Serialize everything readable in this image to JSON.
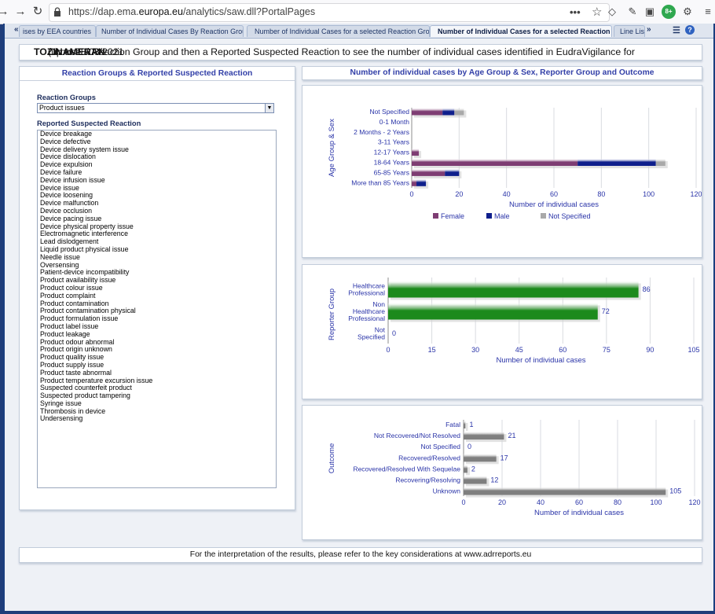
{
  "browser": {
    "url_prefix": "https://dap.ema.",
    "url_domain": "europa.eu",
    "url_suffix": "/analytics/saw.dll?PortalPages",
    "more_label": "•••"
  },
  "tabs": [
    {
      "label": "ises by EEA countries",
      "active": false
    },
    {
      "label": "Number of Individual Cases By Reaction Groups",
      "active": false
    },
    {
      "label": "Number of Individual Cases for a selected Reaction Group",
      "active": false
    },
    {
      "label": "Number of Individual Cases for a selected Reaction",
      "active": true
    },
    {
      "label": "Line Listi",
      "active": false
    }
  ],
  "banner": {
    "text_before": "Choose a Reaction Group and then a Reported Suspected Reaction to see the number of individual cases identified in EudraVigilance for ",
    "drug": "TOZINAMERAN",
    "text_after": " (up to 28/08/2021"
  },
  "left_panel": {
    "title": "Reaction Groups & Reported Suspected Reaction",
    "group_label": "Reaction Groups",
    "group_value": "Product issues",
    "reaction_label": "Reported Suspected Reaction",
    "reactions": [
      "Device breakage",
      "Device defective",
      "Device delivery system issue",
      "Device dislocation",
      "Device expulsion",
      "Device failure",
      "Device infusion issue",
      "Device issue",
      "Device loosening",
      "Device malfunction",
      "Device occlusion",
      "Device pacing issue",
      "Device physical property issue",
      "Electromagnetic interference",
      "Lead dislodgement",
      "Liquid product physical issue",
      "Needle issue",
      "Oversensing",
      "Patient-device incompatibility",
      "Product availability issue",
      "Product colour issue",
      "Product complaint",
      "Product contamination",
      "Product contamination physical",
      "Product formulation issue",
      "Product label issue",
      "Product leakage",
      "Product odour abnormal",
      "Product origin unknown",
      "Product quality issue",
      "Product supply issue",
      "Product taste abnormal",
      "Product temperature excursion issue",
      "Suspected counterfeit product",
      "Suspected product tampering",
      "Syringe issue",
      "Thrombosis in device",
      "Undersensing"
    ]
  },
  "right_header": {
    "title": "Number of individual cases by Age Group & Sex, Reporter Group and Outcome"
  },
  "footer": {
    "text": "For the interpretation of the results, please refer to the key considerations at www.adrreports.eu"
  },
  "colors": {
    "female": "#7e3d73",
    "male": "#0f1f8c",
    "not_specified": "#a9a9a9",
    "reporter": "#1c8a1c",
    "outcome": "#7f7f7f",
    "axis_text": "#2a34a8"
  },
  "chart_data": [
    {
      "type": "bar",
      "orientation": "horizontal",
      "stacked": true,
      "categories": [
        "Not Specified",
        "0-1 Month",
        "2 Months - 2 Years",
        "3-11 Years",
        "12-17 Years",
        "18-64 Years",
        "65-85 Years",
        "More than 85 Years"
      ],
      "series": [
        {
          "name": "Female",
          "values": [
            13,
            0,
            0,
            0,
            3,
            70,
            14,
            2
          ]
        },
        {
          "name": "Male",
          "values": [
            5,
            0,
            0,
            0,
            0,
            33,
            6,
            4
          ]
        },
        {
          "name": "Not Specified",
          "values": [
            4,
            0,
            0,
            0,
            0,
            4,
            0,
            0
          ]
        }
      ],
      "xlabel": "Number of individual cases",
      "ylabel": "Age Group & Sex",
      "xticks": [
        0,
        20,
        40,
        60,
        80,
        100,
        120
      ],
      "xlim": [
        0,
        120
      ],
      "legend": "bottom",
      "grid": true
    },
    {
      "type": "bar",
      "orientation": "horizontal",
      "categories": [
        [
          "Healthcare",
          "Professional"
        ],
        [
          "Non",
          "Healthcare",
          "Professional"
        ],
        [
          "Not",
          "Specified"
        ]
      ],
      "values": [
        86,
        72,
        0
      ],
      "data_labels": [
        "86",
        "72",
        "0"
      ],
      "xlabel": "Number of individual cases",
      "ylabel": "Reporter Group",
      "xticks": [
        0,
        15,
        30,
        45,
        60,
        75,
        90,
        105
      ],
      "xlim": [
        0,
        105
      ],
      "grid": true
    },
    {
      "type": "bar",
      "orientation": "horizontal",
      "categories": [
        "Fatal",
        "Not Recovered/Not Resolved",
        "Not Specified",
        "Recovered/Resolved",
        "Recovered/Resolved With Sequelae",
        "Recovering/Resolving",
        "Unknown"
      ],
      "values": [
        1,
        21,
        0,
        17,
        2,
        12,
        105
      ],
      "data_labels": [
        "1",
        "21",
        "0",
        "17",
        "2",
        "12",
        "105"
      ],
      "xlabel": "Number of individual cases",
      "ylabel": "Outcome",
      "xticks": [
        0,
        20,
        40,
        60,
        80,
        100,
        120
      ],
      "xlim": [
        0,
        120
      ],
      "grid": true
    }
  ]
}
